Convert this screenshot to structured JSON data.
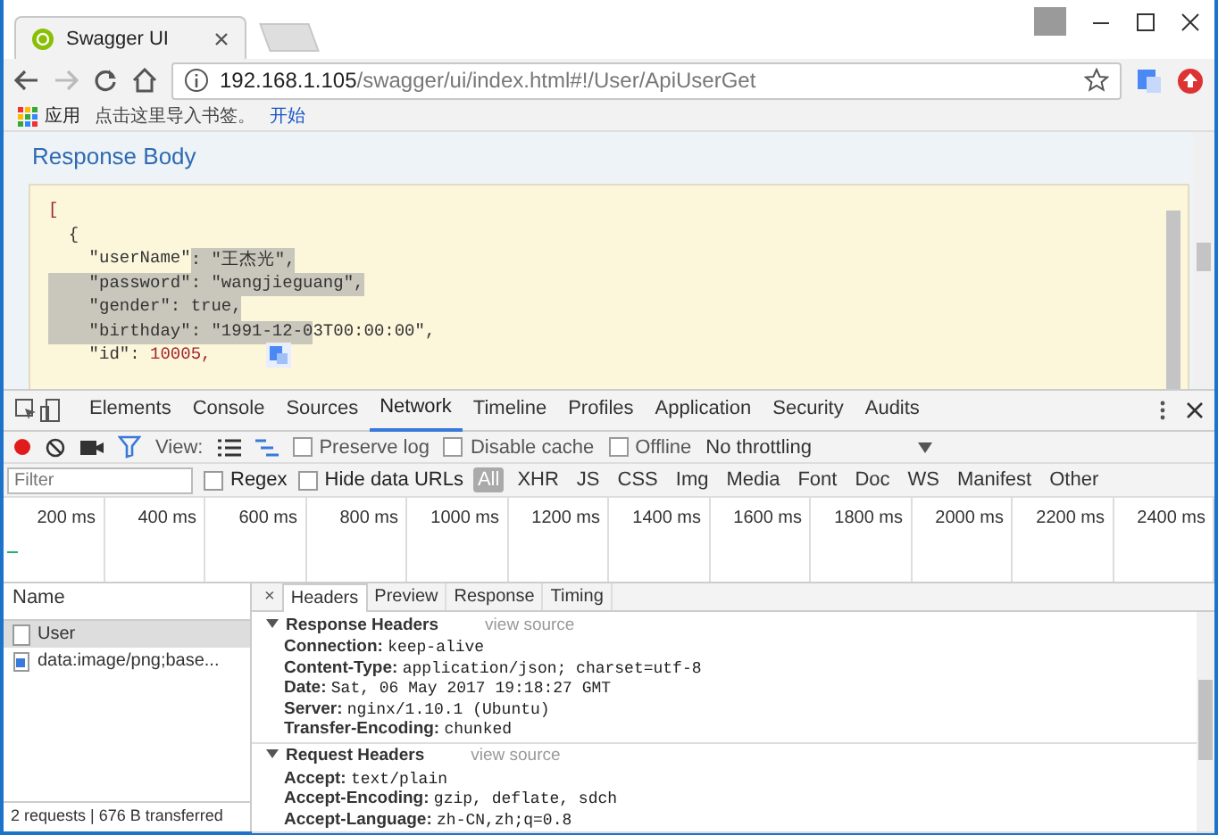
{
  "browser": {
    "tabs": [
      {
        "title": "Swagger UI",
        "selected": true
      }
    ],
    "url": {
      "host": "192.168.1.105",
      "path": "/swagger/ui/index.html#!/User/ApiUserGet"
    },
    "bookmarks": [
      {
        "label": "应用",
        "kind": "apps"
      },
      {
        "label": "点击这里导入书签。",
        "kind": "text"
      },
      {
        "label": "开始",
        "kind": "link"
      }
    ]
  },
  "page": {
    "heading": "Response Body",
    "code_lines": [
      [
        {
          "text": "[",
          "kind": "bracket",
          "selected": false
        }
      ],
      [
        {
          "text": "  {",
          "kind": "plain",
          "selected": false
        }
      ],
      [
        {
          "text": "    \"userName\"",
          "kind": "key",
          "selected": false
        },
        {
          "text": ": \"王杰光\",",
          "kind": "string",
          "selected": true
        }
      ],
      [
        {
          "text": "    \"password\": \"wangjieguang\",",
          "kind": "string",
          "selected": true
        }
      ],
      [
        {
          "text": "    \"gender\": true,",
          "kind": "plain",
          "selected": true
        }
      ],
      [
        {
          "text": "    \"birthday\": \"1991-12-0",
          "kind": "string",
          "selected": true
        },
        {
          "text": "3T00:00:00\",",
          "kind": "string",
          "selected": false
        }
      ],
      [
        {
          "text": "    \"id\": ",
          "kind": "key",
          "selected": false
        },
        {
          "text": "10005,",
          "kind": "number",
          "selected": false
        }
      ]
    ]
  },
  "devtools": {
    "tabs": [
      {
        "label": "Elements",
        "selected": false
      },
      {
        "label": "Console",
        "selected": false
      },
      {
        "label": "Sources",
        "selected": false
      },
      {
        "label": "Network",
        "selected": true
      },
      {
        "label": "Timeline",
        "selected": false
      },
      {
        "label": "Profiles",
        "selected": false
      },
      {
        "label": "Application",
        "selected": false
      },
      {
        "label": "Security",
        "selected": false
      },
      {
        "label": "Audits",
        "selected": false
      }
    ],
    "toolbar": {
      "view_label": "View:",
      "options": [
        {
          "label": "Preserve log",
          "checked": false
        },
        {
          "label": "Disable cache",
          "checked": false
        },
        {
          "label": "Offline",
          "checked": false
        }
      ],
      "throttling": "No throttling"
    },
    "filter": {
      "placeholder": "Filter",
      "options": [
        {
          "label": "Regex",
          "checked": false
        },
        {
          "label": "Hide data URLs",
          "checked": false
        }
      ],
      "types": [
        {
          "label": "All",
          "selected": true
        },
        {
          "label": "XHR",
          "selected": false
        },
        {
          "label": "JS",
          "selected": false
        },
        {
          "label": "CSS",
          "selected": false
        },
        {
          "label": "Img",
          "selected": false
        },
        {
          "label": "Media",
          "selected": false
        },
        {
          "label": "Font",
          "selected": false
        },
        {
          "label": "Doc",
          "selected": false
        },
        {
          "label": "WS",
          "selected": false
        },
        {
          "label": "Manifest",
          "selected": false
        },
        {
          "label": "Other",
          "selected": false
        }
      ]
    },
    "timeline_ticks": [
      "200 ms",
      "400 ms",
      "600 ms",
      "800 ms",
      "1000 ms",
      "1200 ms",
      "1400 ms",
      "1600 ms",
      "1800 ms",
      "2000 ms",
      "2200 ms",
      "2400 ms"
    ],
    "requests": {
      "column": "Name",
      "rows": [
        {
          "name": "User",
          "kind": "document",
          "selected": true
        },
        {
          "name": "data:image/png;base...",
          "kind": "image",
          "selected": false
        }
      ]
    },
    "detail_close": "×",
    "detail_tabs": [
      {
        "label": "Headers",
        "selected": true
      },
      {
        "label": "Preview",
        "selected": false
      },
      {
        "label": "Response",
        "selected": false
      },
      {
        "label": "Timing",
        "selected": false
      }
    ],
    "sections": [
      {
        "title": "Response Headers",
        "link": "view source",
        "expanded": true,
        "headers": [
          {
            "name": "Connection:",
            "value": "keep-alive"
          },
          {
            "name": "Content-Type:",
            "value": "application/json; charset=utf-8"
          },
          {
            "name": "Date:",
            "value": "Sat, 06 May 2017 19:18:27 GMT"
          },
          {
            "name": "Server:",
            "value": "nginx/1.10.1 (Ubuntu)"
          },
          {
            "name": "Transfer-Encoding:",
            "value": "chunked"
          }
        ]
      },
      {
        "title": "Request Headers",
        "link": "view source",
        "expanded": true,
        "headers": [
          {
            "name": "Accept:",
            "value": "text/plain"
          },
          {
            "name": "Accept-Encoding:",
            "value": "gzip, deflate, sdch"
          },
          {
            "name": "Accept-Language:",
            "value": "zh-CN,zh;q=0.8"
          }
        ]
      }
    ],
    "status": "2 requests | 676 B transferred"
  }
}
